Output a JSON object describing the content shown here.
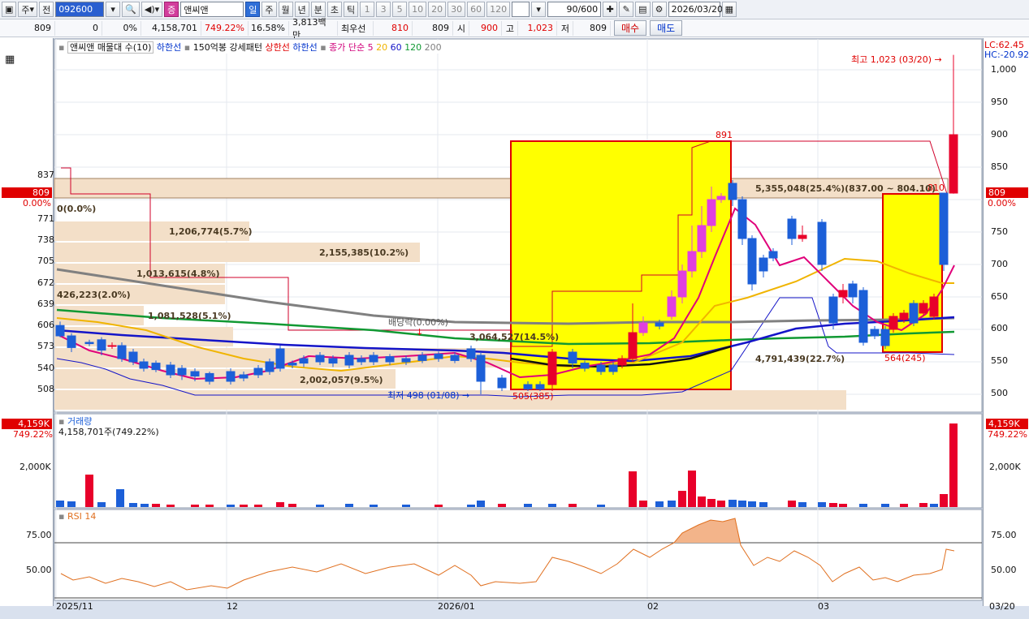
{
  "toolbar": {
    "market": "주",
    "price_type": "전",
    "code": "092600",
    "name": "앤씨앤",
    "cap_label": "증",
    "periods": [
      "일",
      "주",
      "월",
      "년",
      "분",
      "초",
      "틱"
    ],
    "active_period": "일",
    "intervals": [
      "1",
      "3",
      "5",
      "10",
      "20",
      "30",
      "60",
      "120"
    ],
    "pager": "90/600",
    "date": "2026/03/20"
  },
  "info": {
    "price": "809",
    "change": "0",
    "rate": "0%",
    "volume": "4,158,701",
    "vol_rate": "749.22%",
    "turnover": "16.58%",
    "amount": "3,813백만",
    "ask_label": "최우선",
    "ask": "810",
    "bid": "809",
    "open_label": "시",
    "open": "900",
    "high_label": "고",
    "high": "1,023",
    "low_label": "저",
    "low": "809",
    "buy": "매수",
    "sell": "매도"
  },
  "legend": {
    "title": "앤씨앤 매물대 수(10)",
    "low_band": "하한선",
    "pattern": "150억봉 강세패턴",
    "upper": "상한선",
    "lower": "하한선",
    "ma_label": "종가 단순",
    "ma": [
      "5",
      "20",
      "60",
      "120",
      "200"
    ],
    "ma_colors": [
      "#e0007a",
      "#f0b400",
      "#1414c8",
      "#119933",
      "#808080"
    ]
  },
  "price_axis": {
    "right_ticks": [
      "1,000",
      "950",
      "900",
      "850",
      "800",
      "750",
      "700",
      "650",
      "600",
      "550",
      "500"
    ],
    "left_ticks": [
      "837",
      "771",
      "738",
      "705",
      "672",
      "639",
      "606",
      "573",
      "540",
      "508"
    ],
    "lc": "LC:62.45",
    "hc": "HC:-20.92",
    "current": "809",
    "current_rate": "0.00%"
  },
  "annotations": {
    "high": "최고 1,023 (03/20)",
    "low": "최저 498 (01/08)",
    "peak": "891",
    "last_high": "810",
    "box1_low": "505(385)",
    "box2_low": "564(245)",
    "dividend": "배당락(0.00%)"
  },
  "volume_profile": [
    {
      "label": "5,355,048(25.4%)(837.00 ~ 804.10)"
    },
    {
      "label": "0(0.0%)"
    },
    {
      "label": "1,206,774(5.7%)"
    },
    {
      "label": "2,155,385(10.2%)"
    },
    {
      "label": "1,013,615(4.8%)"
    },
    {
      "label": "426,223(2.0%)"
    },
    {
      "label": "1,081,528(5.1%)"
    },
    {
      "label": "3,064,527(14.5%)"
    },
    {
      "label": "2,002,057(9.5%)"
    },
    {
      "label": "4,791,439(22.7%)"
    }
  ],
  "volume_panel": {
    "title": "거래량",
    "value": "4,158,701주(749.22%)",
    "tag": "4,159K",
    "rate": "749.22%",
    "tick": "2,000K"
  },
  "rsi_panel": {
    "title": "RSI 14",
    "ticks": [
      "75.00",
      "50.00"
    ]
  },
  "x_axis": {
    "labels": [
      "2025/11",
      "12",
      "2026/01",
      "02",
      "03"
    ],
    "last": "03/20"
  },
  "colors": {
    "up": "#e8002a",
    "down": "#1c5fd8",
    "box_fill": "#ffff00",
    "box_border": "#e00000",
    "profile": "#f3dfc8"
  }
}
